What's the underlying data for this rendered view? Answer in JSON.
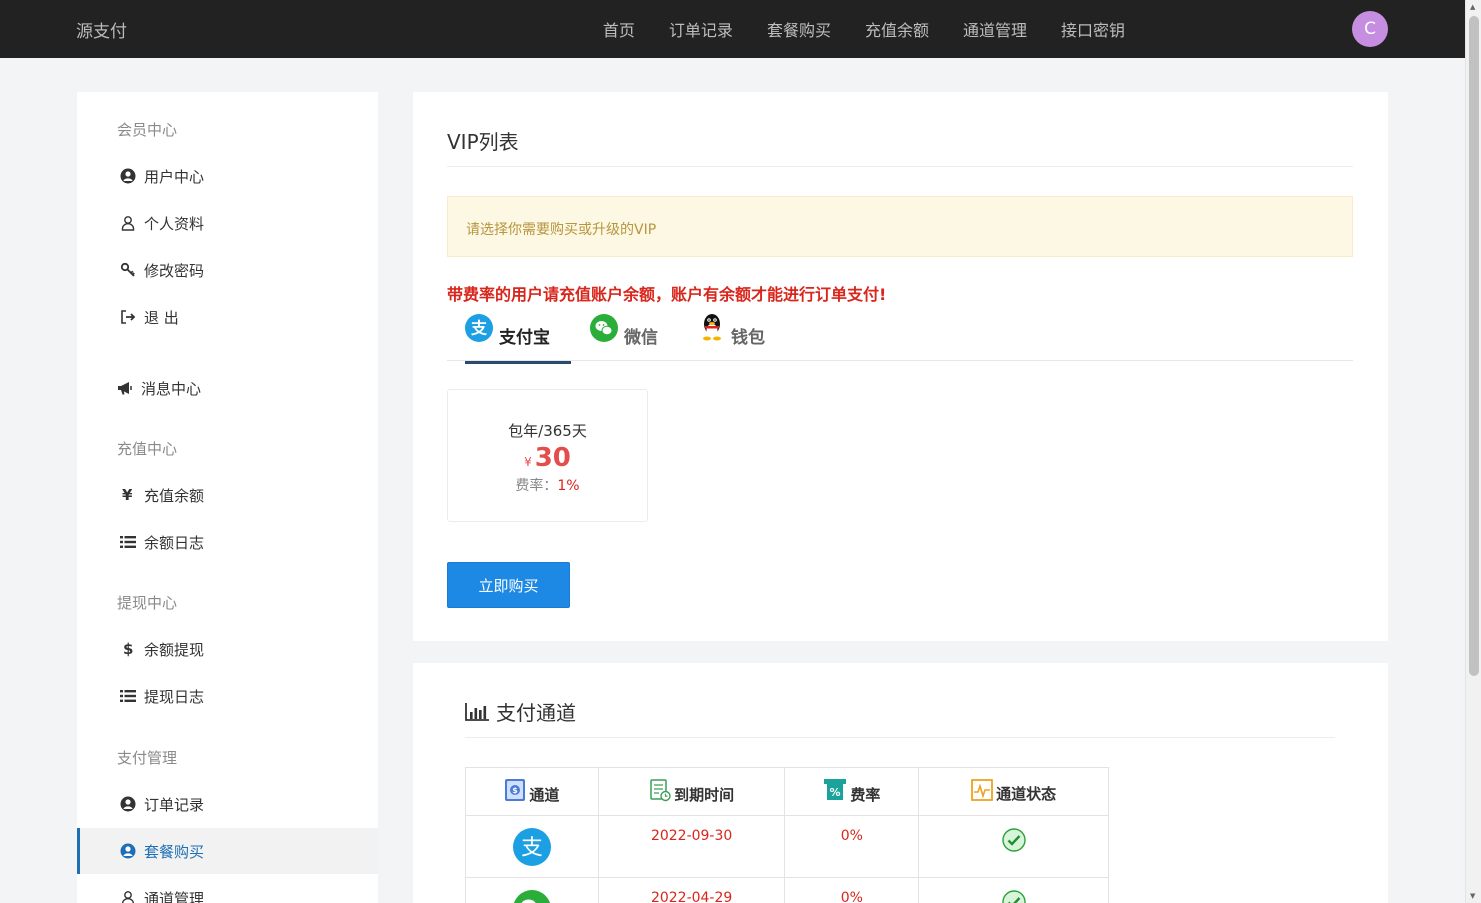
{
  "header": {
    "brand": "源支付",
    "nav": [
      "首页",
      "订单记录",
      "套餐购买",
      "充值余额",
      "通道管理",
      "接口密钥"
    ],
    "avatar_letter": "C"
  },
  "sidebar": {
    "sections": [
      {
        "title": "会员中心",
        "items": [
          {
            "label": "用户中心",
            "icon": "user-circle-icon"
          },
          {
            "label": "个人资料",
            "icon": "user-outline-icon"
          },
          {
            "label": "修改密码",
            "icon": "key-icon"
          },
          {
            "label": "退 出",
            "icon": "sign-out-icon"
          }
        ]
      },
      {
        "title": "",
        "items": [
          {
            "label": "消息中心",
            "icon": "bullhorn-icon"
          }
        ]
      },
      {
        "title": "充值中心",
        "items": [
          {
            "label": "充值余额",
            "icon": "yen-icon"
          },
          {
            "label": "余额日志",
            "icon": "list-icon"
          }
        ]
      },
      {
        "title": "提现中心",
        "items": [
          {
            "label": "余额提现",
            "icon": "dollar-icon"
          },
          {
            "label": "提现日志",
            "icon": "list-icon"
          }
        ]
      },
      {
        "title": "支付管理",
        "items": [
          {
            "label": "订单记录",
            "icon": "user-circle-icon"
          },
          {
            "label": "套餐购买",
            "icon": "user-circle-icon",
            "active": true
          },
          {
            "label": "通道管理",
            "icon": "user-outline-icon"
          }
        ]
      }
    ]
  },
  "vip": {
    "title": "VIP列表",
    "alert": "请选择你需要购买或升级的VIP",
    "warning": "带费率的用户请充值账户余额，账户有余额才能进行订单支付!",
    "tabs": [
      {
        "label": "支付宝",
        "active": true
      },
      {
        "label": "微信"
      },
      {
        "label": "钱包"
      }
    ],
    "plan": {
      "name": "包年/365天",
      "currency": "¥",
      "price": "30",
      "rate_label": "费率：",
      "rate": "1%"
    },
    "buy_label": "立即购买"
  },
  "channels": {
    "title": "支付通道",
    "headers": [
      "通道",
      "到期时间",
      "费率",
      "通道状态"
    ],
    "rows": [
      {
        "channel": "alipay",
        "expire": "2022-09-30",
        "rate": "0%",
        "status": "enabled"
      },
      {
        "channel": "wechat",
        "expire": "2022-04-29",
        "rate": "0%",
        "status": "enabled"
      }
    ]
  },
  "colors": {
    "accent": "#1e88e5",
    "danger": "#d9261c",
    "alipay": "#1ca0e3",
    "wechat": "#2aae39",
    "topbar": "#222222"
  }
}
